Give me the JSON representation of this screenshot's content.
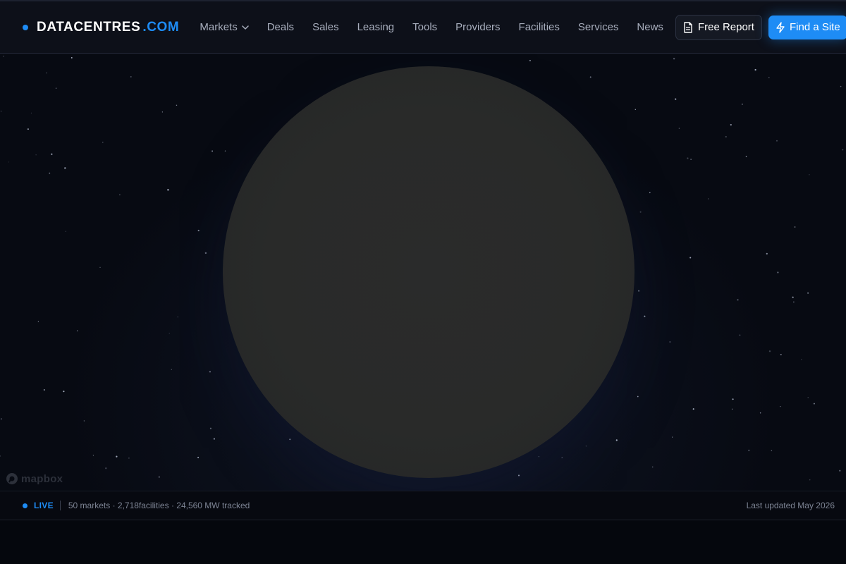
{
  "brand": {
    "name": "DATACENTRES",
    "tld": ".COM"
  },
  "nav": {
    "items": [
      {
        "label": "Markets",
        "has_dropdown": true
      },
      {
        "label": "Deals"
      },
      {
        "label": "Sales"
      },
      {
        "label": "Leasing"
      },
      {
        "label": "Tools"
      },
      {
        "label": "Providers"
      },
      {
        "label": "Facilities"
      },
      {
        "label": "Services"
      },
      {
        "label": "News"
      }
    ],
    "free_report": {
      "label": "Free Report",
      "icon": "document-icon"
    },
    "find_site": {
      "label": "Find a Site",
      "icon": "lightning-icon"
    }
  },
  "map": {
    "attribution": "mapbox"
  },
  "status": {
    "live_label": "LIVE",
    "stats": "50 markets · 2,718facilities · 24,560 MW tracked",
    "updated": "Last updated May 2026"
  },
  "colors": {
    "accent": "#1e8cf5",
    "background": "#05070d",
    "navbar": "#0d1019",
    "globe": "#2a2b2b"
  }
}
